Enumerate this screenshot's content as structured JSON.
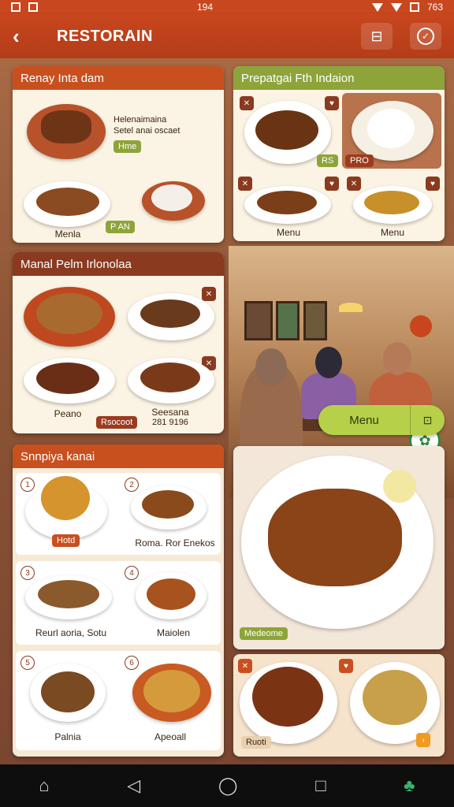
{
  "status_bar": {
    "time": "194",
    "battery": "763"
  },
  "app_bar": {
    "title": "RESTORAIN"
  },
  "cards": {
    "top_left": {
      "title": "Renay Inta dam",
      "desc_line1": "Helenaimaina",
      "desc_line2": "Setel anai oscaet",
      "tag": "Hme",
      "label_left": "Menla",
      "label_right": "P AN"
    },
    "top_right": {
      "title": "Prepatgai Fth Indaion",
      "chip": "RS",
      "chip2": "PRO",
      "label_left": "Menu",
      "label_right": "Menu"
    },
    "mid_left": {
      "title": "Manal Pelm Irlonolaa",
      "label_left": "Peano",
      "tag_left": "Rsocoot",
      "label_right1": "Seesana",
      "label_right2": "281 9196"
    },
    "list": {
      "title": "Snnpiya kanai",
      "items": [
        {
          "num": "1",
          "label": "",
          "tag": "Hotd"
        },
        {
          "num": "2",
          "label": "Roma. Ror Enekos",
          "tag": ""
        },
        {
          "num": "3",
          "label": "Reurl aoria, Sotu",
          "tag": ""
        },
        {
          "num": "4",
          "label": "Maiolen",
          "tag": ""
        },
        {
          "num": "5",
          "label": "Palnia",
          "tag": ""
        },
        {
          "num": "6",
          "label": "Apeoall",
          "tag": ""
        }
      ]
    },
    "feature": {
      "tag": "Medeome"
    },
    "bottom_right": {
      "tag": "Ruoti"
    }
  },
  "menu_pill": {
    "label": "Menu"
  },
  "colors": {
    "primary": "#c8461e",
    "accent": "#8ea43a",
    "pill": "#b7d04a"
  }
}
